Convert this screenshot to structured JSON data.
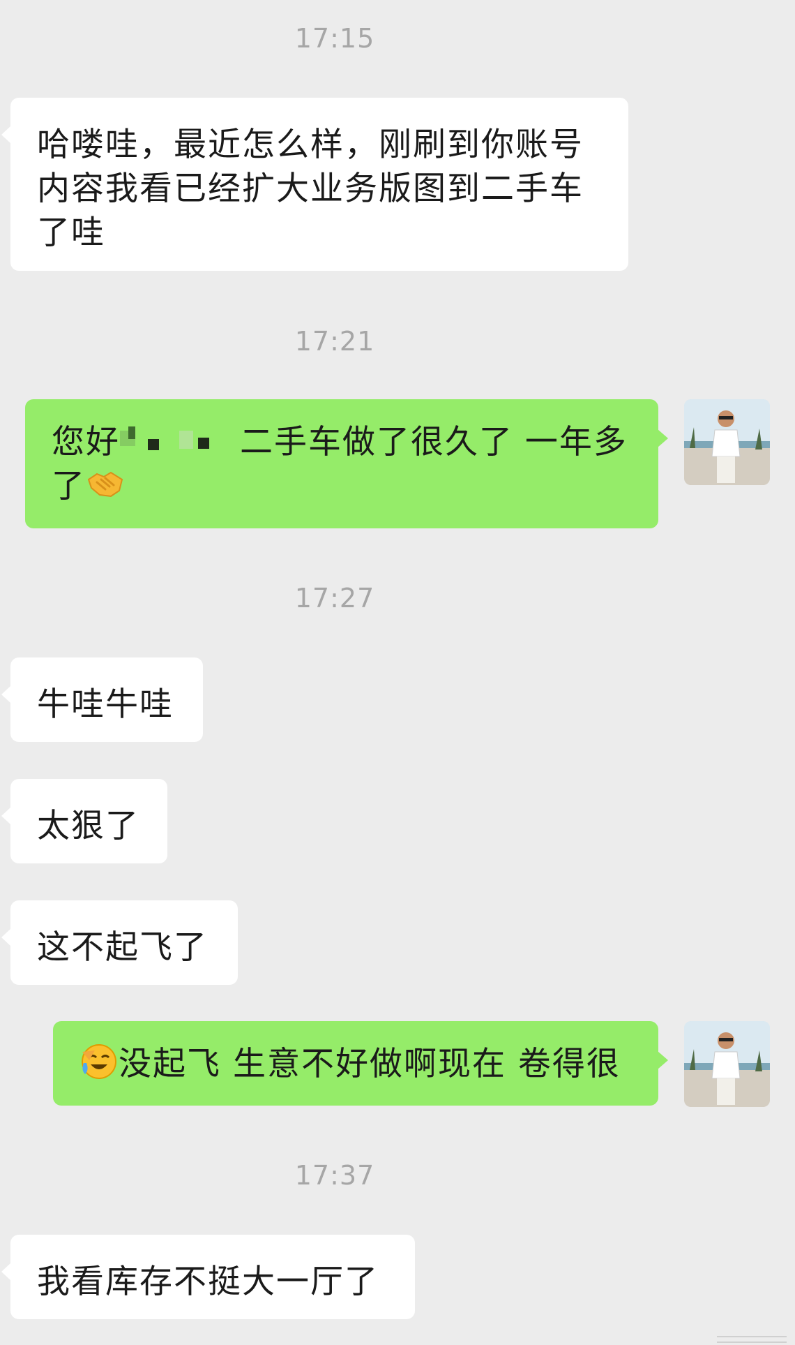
{
  "timestamps": [
    "17:15",
    "17:21",
    "17:27",
    "17:37"
  ],
  "messages": [
    {
      "side": "in",
      "text": "哈喽哇，最近怎么样，刚刷到你账号内容我看已经扩大业务版图到二手车了哇"
    },
    {
      "side": "out",
      "text_before_redaction": "您好",
      "text_after_redaction": " 二手车做了很久了 一年多了",
      "emoji_after": "handshake-emoji"
    },
    {
      "side": "in",
      "text": "牛哇牛哇"
    },
    {
      "side": "in",
      "text": "太狠了"
    },
    {
      "side": "in",
      "text": "这不起飞了"
    },
    {
      "side": "out",
      "emoji_before": "crying-laughing-emoji",
      "text": "没起飞 生意不好做啊现在 卷得很"
    },
    {
      "side": "in",
      "text": "我看库存不挺大一厅了"
    }
  ],
  "colors": {
    "background": "#ececec",
    "incoming_bubble": "#ffffff",
    "outgoing_bubble": "#95ec69",
    "timestamp_text": "#a6a6a6"
  }
}
